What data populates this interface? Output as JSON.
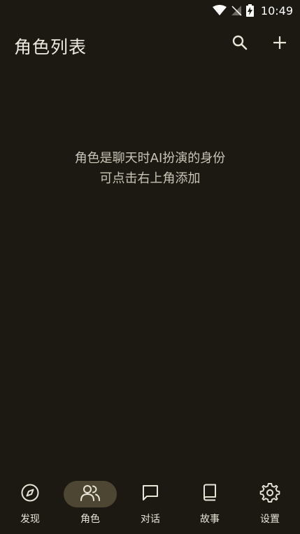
{
  "status_bar": {
    "time": "10:49"
  },
  "header": {
    "title": "角色列表",
    "search_icon": "search-icon",
    "add_icon": "plus-icon"
  },
  "empty_state": {
    "line1": "角色是聊天时AI扮演的身份",
    "line2": "可点击右上角添加"
  },
  "bottom_nav": {
    "active": "角色",
    "items": [
      {
        "label": "发现",
        "icon": "compass-icon"
      },
      {
        "label": "角色",
        "icon": "users-icon"
      },
      {
        "label": "对话",
        "icon": "chat-icon"
      },
      {
        "label": "故事",
        "icon": "book-icon"
      },
      {
        "label": "设置",
        "icon": "gear-icon"
      }
    ]
  },
  "colors": {
    "background": "#1b1912",
    "active_pill": "#4c4633",
    "text": "#e8e4d8"
  }
}
